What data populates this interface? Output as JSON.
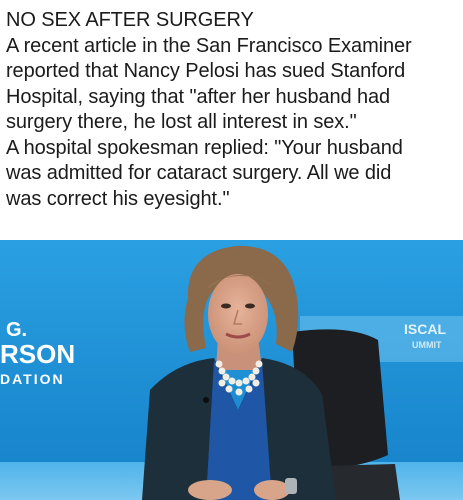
{
  "caption": {
    "lines": [
      "NO SEX AFTER SURGERY",
      "A recent article in the San Francisco Examiner",
      "reported that Nancy Pelosi has sued Stanford",
      "Hospital, saying that \"after her husband had",
      "surgery there, he lost all interest in sex.\"",
      "A hospital spokesman replied: \"Your husband",
      "was admitted for cataract surgery. All we did",
      "was correct his eyesight.\""
    ]
  },
  "photo": {
    "backdrop_left": [
      "G.",
      "RSON",
      "DATION"
    ],
    "backdrop_right": [
      "ISCAL",
      "UMMIT"
    ],
    "colors": {
      "backdrop": "#1a8fd4",
      "jacket": "#1d2f3a",
      "blouse": "#1f56a6",
      "hair": "#8a6a4a",
      "skin": "#d9a58a",
      "chair": "#1c1e22"
    }
  }
}
